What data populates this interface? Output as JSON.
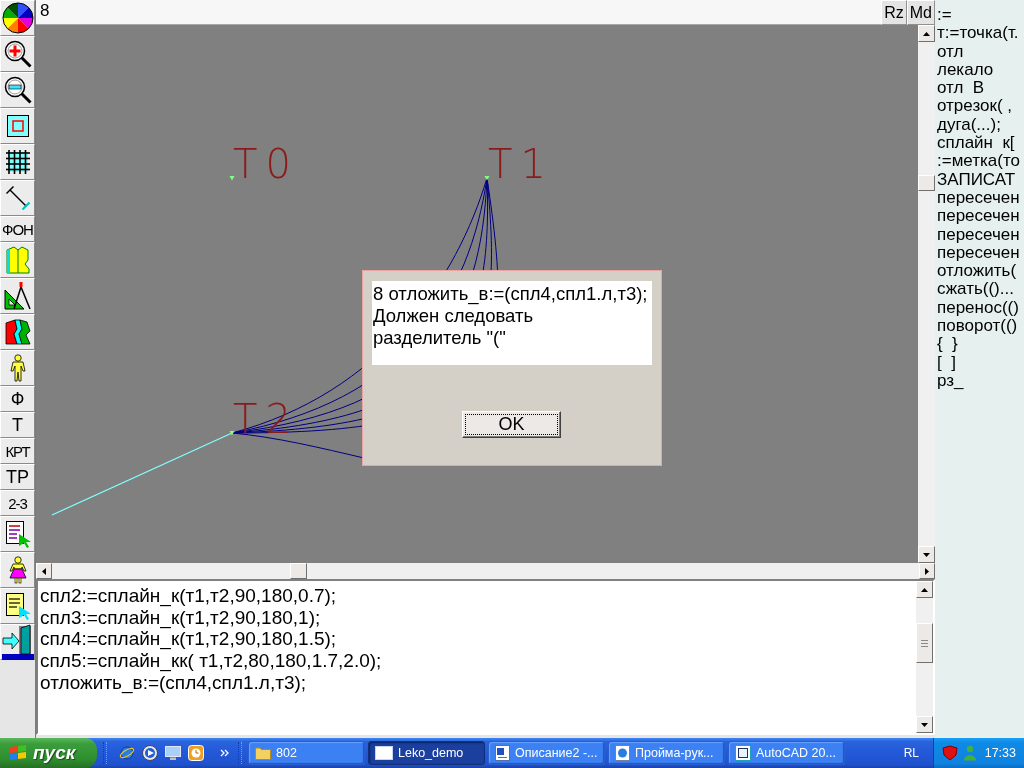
{
  "toolbar": {
    "buttons": [
      {
        "kind": "palette"
      },
      {
        "kind": "zoom-in"
      },
      {
        "kind": "zoom-out"
      },
      {
        "kind": "frame"
      },
      {
        "kind": "grid"
      },
      {
        "kind": "measure"
      },
      {
        "kind": "text",
        "label": "ФОН"
      },
      {
        "kind": "pattern"
      },
      {
        "kind": "compass"
      },
      {
        "kind": "layers"
      },
      {
        "kind": "mannequin"
      },
      {
        "kind": "text",
        "label": "Ф"
      },
      {
        "kind": "text",
        "label": "Т"
      },
      {
        "kind": "text",
        "label": "КРТ"
      },
      {
        "kind": "text",
        "label": "ТР"
      },
      {
        "kind": "text",
        "label": "2-3"
      },
      {
        "kind": "document"
      },
      {
        "kind": "dress"
      },
      {
        "kind": "note"
      },
      {
        "kind": "exit"
      }
    ]
  },
  "top_bar": {
    "line_number": "8",
    "buttons": [
      {
        "label": "Rz"
      },
      {
        "label": "Md"
      }
    ]
  },
  "canvas": {
    "points": [
      {
        "label": "Т0"
      },
      {
        "label": "Т1"
      },
      {
        "label": "Т2"
      }
    ]
  },
  "dialog": {
    "message": [
      "8 отложить_в:=(спл4,спл1.л,т3);",
      "Должен следовать",
      "разделитель \"(\""
    ],
    "button": "OK"
  },
  "editor": {
    "lines": [
      "спл2:=сплайн_к(т1,т2,90,180,0.7);",
      "спл3:=сплайн_к(т1,т2,90,180,1);",
      "спл4:=сплайн_к(т1,т2,90,180,1.5);",
      "спл5:=сплайн_кк( т1,т2,80,180,1.7,2.0);",
      "отложить_в:=(спл4,спл1.л,т3);"
    ]
  },
  "command_list": {
    "items": [
      ":=",
      "т:=точка(т.",
      "отл",
      "лекало",
      "отл  В",
      "отрезок( ,",
      "дуга(...);",
      "сплайн  к[",
      ":=метка(то",
      "ЗАПИСАТ",
      "пересечен",
      "пересечен",
      "пересечен",
      "пересечен",
      "отложить(",
      "сжать(()...",
      "перенос(()",
      "поворот(()",
      "{  }",
      "[  ]",
      "рз_"
    ]
  },
  "taskbar": {
    "start_button": "пуск",
    "windows": [
      {
        "kind": "folder",
        "label": "802",
        "selected": false
      },
      {
        "kind": "window",
        "label": "Leko_demo",
        "selected": true
      },
      {
        "kind": "document",
        "label": "Описание2 -...",
        "selected": false
      },
      {
        "kind": "web-page",
        "label": "Пройма-рук...",
        "selected": false
      },
      {
        "kind": "app",
        "label": "AutoCAD 20...",
        "selected": false
      }
    ],
    "language": "RL",
    "clock": "17:33"
  }
}
